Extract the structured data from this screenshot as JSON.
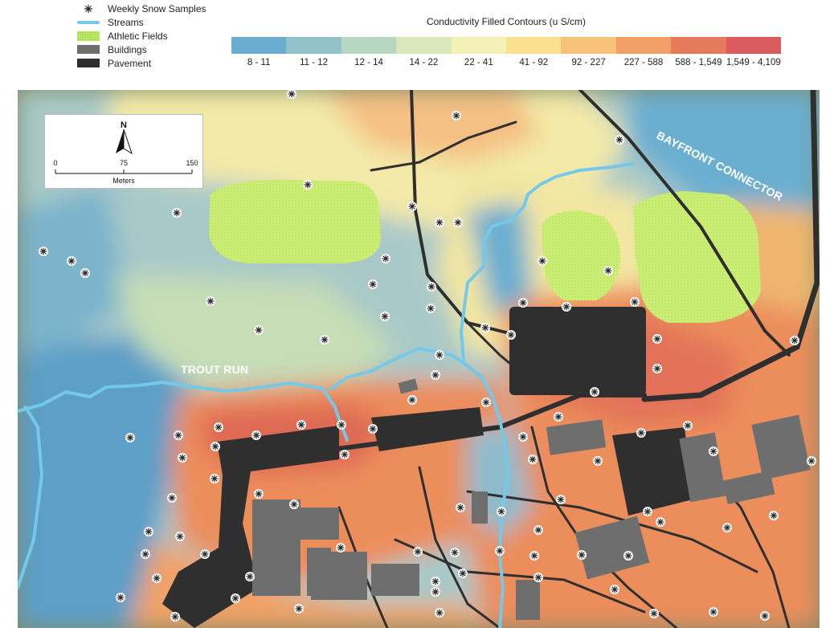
{
  "legend": {
    "items": [
      {
        "label": "Weekly Snow Samples",
        "icon": "snow-sample-icon"
      },
      {
        "label": "Streams",
        "icon": "stream-line-icon"
      },
      {
        "label": "Athletic Fields",
        "icon": "athletic-field-swatch"
      },
      {
        "label": "Buildings",
        "icon": "building-swatch"
      },
      {
        "label": "Pavement",
        "icon": "pavement-swatch"
      }
    ]
  },
  "conductivity": {
    "title": "Conductivity Filled Contours (u S/cm)",
    "classes": [
      {
        "label": "8 - 11",
        "color": "#6aadd0"
      },
      {
        "label": "11 - 12",
        "color": "#94c2cb"
      },
      {
        "label": "12 - 14",
        "color": "#b8d7c3"
      },
      {
        "label": "14 - 22",
        "color": "#d8e8ba"
      },
      {
        "label": "22 - 41",
        "color": "#f3f1b6"
      },
      {
        "label": "41 - 92",
        "color": "#f9e08e"
      },
      {
        "label": "92 - 227",
        "color": "#f8c27a"
      },
      {
        "label": "227 - 588",
        "color": "#f0a064"
      },
      {
        "label": "588 - 1,549",
        "color": "#e57a5a"
      },
      {
        "label": "1,549 - 4,109",
        "color": "#db5a5e"
      }
    ]
  },
  "scale_bar": {
    "north_label": "N",
    "ticks": [
      "0",
      "75",
      "150"
    ],
    "unit": "Meters"
  },
  "map_labels": {
    "stream": "TROUT RUN",
    "road": "BAYFRONT CONNECTOR"
  },
  "colors": {
    "stream": "#74c9ea",
    "field": "#c8ec6c",
    "building": "#6e6e6e",
    "pavement": "#2f2f2f"
  }
}
